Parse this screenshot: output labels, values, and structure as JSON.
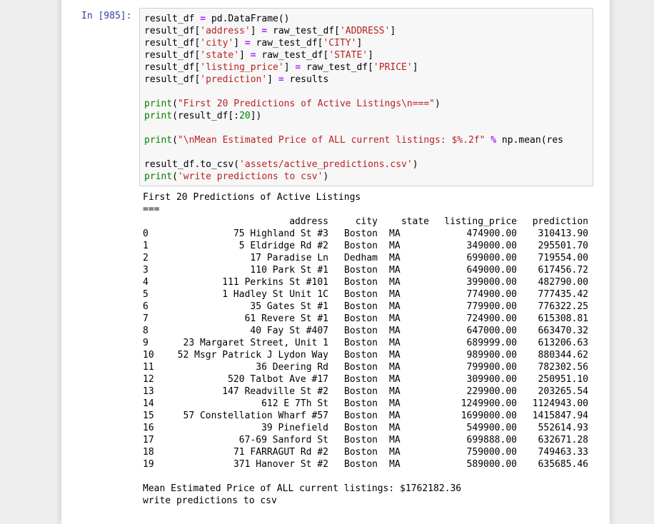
{
  "cell": {
    "prompt": "In [985]:",
    "code_lines": [
      [
        {
          "t": "result_df "
        },
        {
          "t": "=",
          "c": "o"
        },
        {
          "t": " pd.DataFrame()"
        }
      ],
      [
        {
          "t": "result_df["
        },
        {
          "t": "'address'",
          "c": "s"
        },
        {
          "t": "] "
        },
        {
          "t": "=",
          "c": "o"
        },
        {
          "t": " raw_test_df["
        },
        {
          "t": "'ADDRESS'",
          "c": "s"
        },
        {
          "t": "]"
        }
      ],
      [
        {
          "t": "result_df["
        },
        {
          "t": "'city'",
          "c": "s"
        },
        {
          "t": "] "
        },
        {
          "t": "=",
          "c": "o"
        },
        {
          "t": " raw_test_df["
        },
        {
          "t": "'CITY'",
          "c": "s"
        },
        {
          "t": "]"
        }
      ],
      [
        {
          "t": "result_df["
        },
        {
          "t": "'state'",
          "c": "s"
        },
        {
          "t": "] "
        },
        {
          "t": "=",
          "c": "o"
        },
        {
          "t": " raw_test_df["
        },
        {
          "t": "'STATE'",
          "c": "s"
        },
        {
          "t": "]"
        }
      ],
      [
        {
          "t": "result_df["
        },
        {
          "t": "'listing_price'",
          "c": "s"
        },
        {
          "t": "] "
        },
        {
          "t": "=",
          "c": "o"
        },
        {
          "t": " raw_test_df["
        },
        {
          "t": "'PRICE'",
          "c": "s"
        },
        {
          "t": "]"
        }
      ],
      [
        {
          "t": "result_df["
        },
        {
          "t": "'prediction'",
          "c": "s"
        },
        {
          "t": "] "
        },
        {
          "t": "=",
          "c": "o"
        },
        {
          "t": " results"
        }
      ],
      [],
      [
        {
          "t": "print",
          "c": "k"
        },
        {
          "t": "("
        },
        {
          "t": "\"First 20 Predictions of Active Listings\\n===\"",
          "c": "s"
        },
        {
          "t": ")"
        }
      ],
      [
        {
          "t": "print",
          "c": "k"
        },
        {
          "t": "(result_df[:"
        },
        {
          "t": "20",
          "c": "n"
        },
        {
          "t": "])"
        }
      ],
      [],
      [
        {
          "t": "print",
          "c": "k"
        },
        {
          "t": "("
        },
        {
          "t": "\"\\nMean Estimated Price of ALL current listings: $%.2f\"",
          "c": "s"
        },
        {
          "t": " "
        },
        {
          "t": "%",
          "c": "o"
        },
        {
          "t": " np.mean(res"
        }
      ],
      [],
      [
        {
          "t": "result_df.to_csv("
        },
        {
          "t": "'assets/active_predictions.csv'",
          "c": "s"
        },
        {
          "t": ")"
        }
      ],
      [
        {
          "t": "print",
          "c": "k"
        },
        {
          "t": "("
        },
        {
          "t": "'write predictions to csv'",
          "c": "s"
        },
        {
          "t": ")"
        }
      ]
    ]
  },
  "output": {
    "header_line1": "First 20 Predictions of Active Listings",
    "header_line2": "===",
    "columns": [
      "address",
      "city",
      "state",
      "listing_price",
      "prediction"
    ],
    "rows": [
      [
        "0",
        "75 Highland St #3",
        "Boston",
        "MA",
        "474900.00",
        "310413.90"
      ],
      [
        "1",
        "5 Eldridge Rd #2",
        "Boston",
        "MA",
        "349000.00",
        "295501.70"
      ],
      [
        "2",
        "17 Paradise Ln",
        "Dedham",
        "MA",
        "699000.00",
        "719554.00"
      ],
      [
        "3",
        "110 Park St #1",
        "Boston",
        "MA",
        "649000.00",
        "617456.72"
      ],
      [
        "4",
        "111 Perkins St #101",
        "Boston",
        "MA",
        "399000.00",
        "482790.00"
      ],
      [
        "5",
        "1 Hadley St Unit 1C",
        "Boston",
        "MA",
        "774900.00",
        "777435.42"
      ],
      [
        "6",
        "35 Gates St #1",
        "Boston",
        "MA",
        "779900.00",
        "776322.25"
      ],
      [
        "7",
        "61 Revere St #1",
        "Boston",
        "MA",
        "724900.00",
        "615308.81"
      ],
      [
        "8",
        "40 Fay St #407",
        "Boston",
        "MA",
        "647000.00",
        "663470.32"
      ],
      [
        "9",
        "23 Margaret Street, Unit 1",
        "Boston",
        "MA",
        "689999.00",
        "613206.63"
      ],
      [
        "10",
        "52 Msgr Patrick J Lydon Way",
        "Boston",
        "MA",
        "989900.00",
        "880344.62"
      ],
      [
        "11",
        "36 Deering Rd",
        "Boston",
        "MA",
        "799900.00",
        "782302.56"
      ],
      [
        "12",
        "520 Talbot Ave #17",
        "Boston",
        "MA",
        "309900.00",
        "250951.10"
      ],
      [
        "13",
        "147 Readville St #2",
        "Boston",
        "MA",
        "229900.00",
        "203265.54"
      ],
      [
        "14",
        "612 E 7Th St",
        "Boston",
        "MA",
        "1249900.00",
        "1124943.00"
      ],
      [
        "15",
        "57 Constellation Wharf #57",
        "Boston",
        "MA",
        "1699000.00",
        "1415847.94"
      ],
      [
        "16",
        "39 Pinefield",
        "Boston",
        "MA",
        "549900.00",
        "552614.93"
      ],
      [
        "17",
        "67-69 Sanford St",
        "Boston",
        "MA",
        "699888.00",
        "632671.28"
      ],
      [
        "18",
        "71 FARRAGUT Rd #2",
        "Boston",
        "MA",
        "759000.00",
        "749463.33"
      ],
      [
        "19",
        "371 Hanover St #2",
        "Boston",
        "MA",
        "589000.00",
        "635685.46"
      ]
    ],
    "mean_line": "Mean Estimated Price of ALL current listings: $1762182.36",
    "write_line": "write predictions to csv"
  },
  "colors": {
    "prompt": "#303f9f",
    "string": "#ba2121",
    "keyword": "#008000",
    "operator": "#aa22ff",
    "input_bg": "#f7f7f7",
    "page_bg": "#eeeeee"
  }
}
